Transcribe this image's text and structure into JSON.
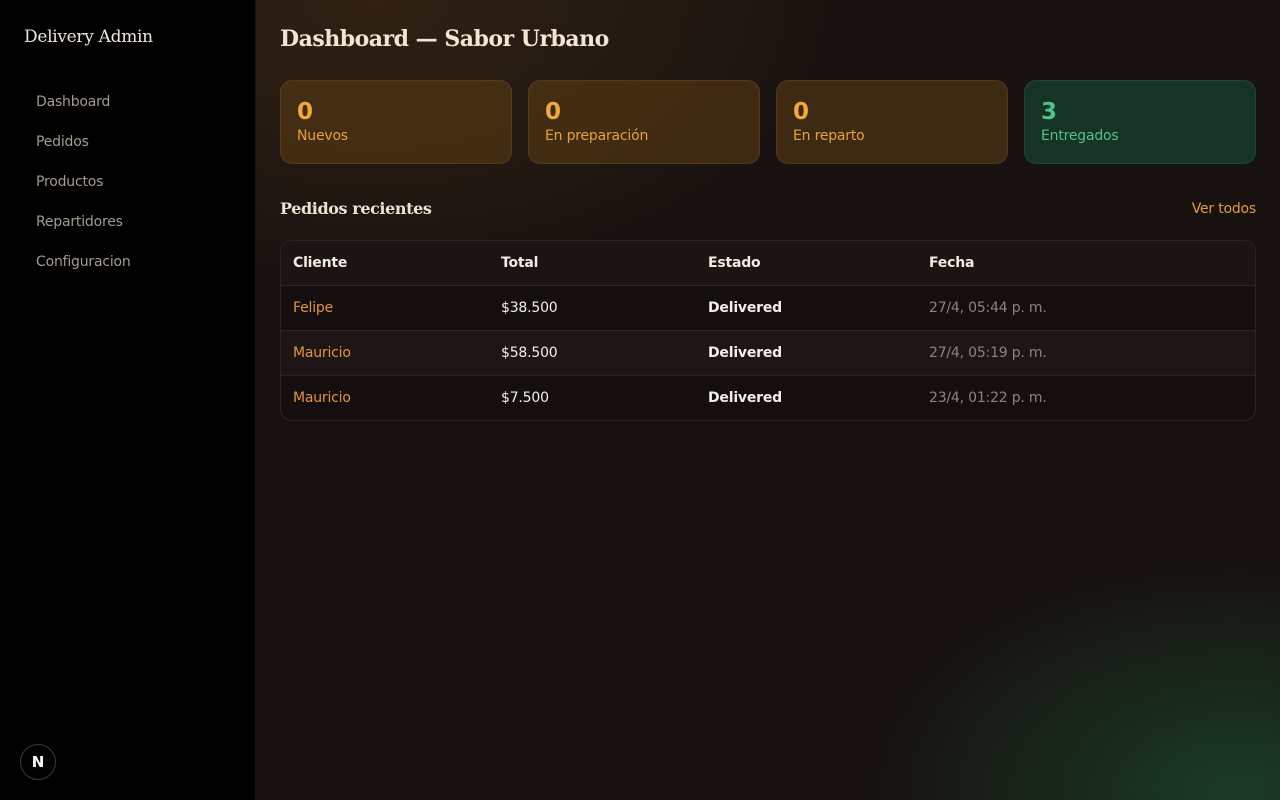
{
  "sidebar": {
    "brand": "Delivery Admin",
    "items": [
      {
        "label": "Dashboard"
      },
      {
        "label": "Pedidos"
      },
      {
        "label": "Productos"
      },
      {
        "label": "Repartidores"
      },
      {
        "label": "Configuracion"
      }
    ],
    "badge": "N",
    "badge_icon": "nextjs-logo-icon"
  },
  "main": {
    "title": "Dashboard — Sabor Urbano",
    "stats": [
      {
        "value": "0",
        "label": "Nuevos"
      },
      {
        "value": "0",
        "label": "En preparación"
      },
      {
        "value": "0",
        "label": "En reparto"
      },
      {
        "value": "3",
        "label": "Entregados"
      }
    ],
    "recent": {
      "title": "Pedidos recientes",
      "view_all": "Ver todos",
      "columns": [
        "Cliente",
        "Total",
        "Estado",
        "Fecha"
      ],
      "rows": [
        {
          "client": "Felipe",
          "total": "$38.500",
          "status": "Delivered",
          "date": "27/4, 05:44 p. m."
        },
        {
          "client": "Mauricio",
          "total": "$58.500",
          "status": "Delivered",
          "date": "27/4, 05:19 p. m."
        },
        {
          "client": "Mauricio",
          "total": "$7.500",
          "status": "Delivered",
          "date": "23/4, 01:22 p. m."
        }
      ]
    }
  },
  "colors": {
    "accent": "#e3943a",
    "success": "#4cc48b",
    "background": "#171210",
    "sidebar": "#000000"
  }
}
